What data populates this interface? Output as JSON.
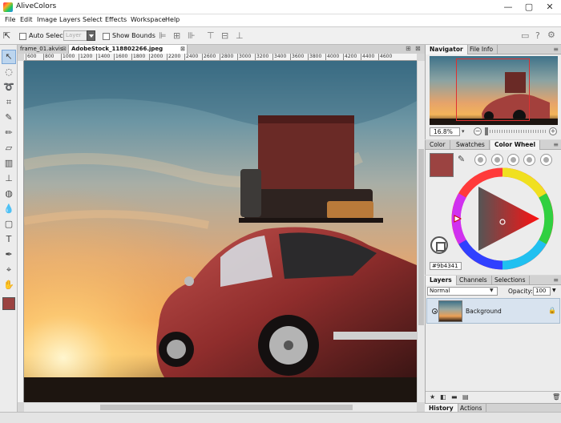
{
  "app": {
    "title": "AliveColors",
    "window_buttons": [
      "—",
      "▢",
      "✕"
    ]
  },
  "menu": [
    "File",
    "Edit",
    "Image",
    "Layers",
    "Select",
    "Effects",
    "Workspace",
    "Help"
  ],
  "toolbar": {
    "auto_select_label": "Auto Select",
    "auto_select_checked": false,
    "layer_select_value": "Layer",
    "show_bounds_label": "Show Bounds",
    "show_bounds_checked": false
  },
  "documents": {
    "tabs": [
      {
        "label": "frame_01.akvis",
        "active": false
      },
      {
        "label": "AdobeStock_118802266.jpeg",
        "active": true
      }
    ]
  },
  "ruler": {
    "ticks": [
      "600",
      "800",
      "1000",
      "1200",
      "1400",
      "1600",
      "1800",
      "2000",
      "2200",
      "2400",
      "2600",
      "2800",
      "3000",
      "3200",
      "3400",
      "3600",
      "3800",
      "4000",
      "4200",
      "4400",
      "4600"
    ]
  },
  "navigator": {
    "tabs": [
      "Navigator",
      "File Info"
    ],
    "zoom": "16.8%",
    "zoom_out": "−",
    "zoom_in": "+"
  },
  "color_panel": {
    "tabs": [
      "Color",
      "Swatches",
      "Color Wheel"
    ],
    "current_color": "#9b4341",
    "hex": "#9b4341"
  },
  "layers": {
    "tabs": [
      "Layers",
      "Channels",
      "Selections"
    ],
    "blend_mode": "Normal",
    "opacity_label": "Opacity:",
    "opacity_value": "100",
    "items": [
      {
        "name": "Background",
        "visible": true,
        "locked": true
      }
    ]
  },
  "bottom_tabs": [
    "History",
    "Actions"
  ]
}
